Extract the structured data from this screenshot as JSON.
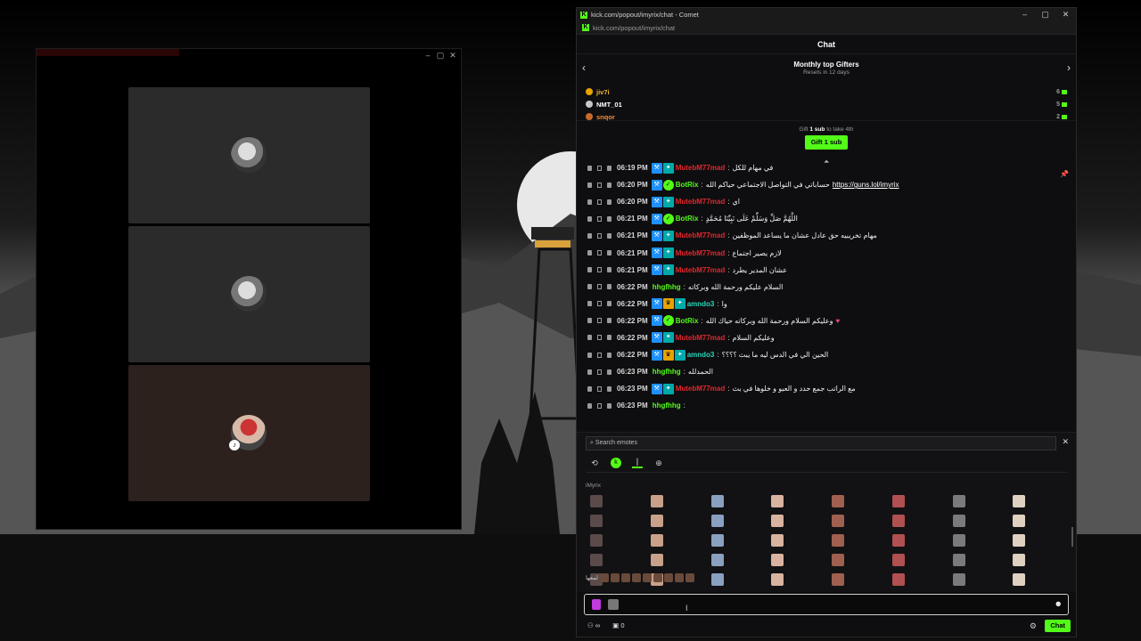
{
  "call_window": {
    "tiles": [
      {
        "kind": "avatar"
      },
      {
        "kind": "avatar"
      },
      {
        "kind": "avatar-muted"
      }
    ]
  },
  "browser": {
    "title": "kick.com/popout/imyrix/chat - Comet",
    "url": "kick.com/popout/imyrix/chat",
    "controls": {
      "minimize": "–",
      "maximize": "▢",
      "close": "✕"
    }
  },
  "chat": {
    "header": "Chat",
    "gifters": {
      "title": "Monthly top Gifters",
      "subtitle": "Resets in 12 days",
      "list": [
        {
          "name": "jiv7i",
          "count": "6",
          "color": "#e8a300",
          "name_color": "#f0b429"
        },
        {
          "name": "NMT_01",
          "count": "5",
          "color": "#c7c7c7",
          "name_color": "#ffffff"
        },
        {
          "name": "snqor",
          "count": "2",
          "color": "#c96a2a",
          "name_color": "#f08a3a"
        }
      ],
      "cta_prefix": "Gift",
      "cta_bold": "1 sub",
      "cta_suffix": "to take 4th",
      "gift_button": "Gift 1 sub"
    },
    "messages": [
      {
        "time": "06:19 PM",
        "badges": [
          "blue",
          "teal"
        ],
        "user": "MutebM77mad",
        "user_class": "u-red",
        "text": "في مهام للكل"
      },
      {
        "time": "06:20 PM",
        "badges": [
          "blue",
          "green"
        ],
        "user": "BotRix",
        "user_class": "u-green",
        "text": "حساباتي في التواصل الاجتماعي حياكم الله",
        "link": "https://guns.lol/imyrix"
      },
      {
        "time": "06:20 PM",
        "badges": [
          "blue",
          "teal"
        ],
        "user": "MutebM77mad",
        "user_class": "u-red",
        "text": "اي"
      },
      {
        "time": "06:21 PM",
        "badges": [
          "blue",
          "green"
        ],
        "user": "BotRix",
        "user_class": "u-green",
        "text": "اللَّهُمَّ صَلِّ وَسَلِّمْ عَلَى نَبِيِّنَا مُحَمَّدٍ"
      },
      {
        "time": "06:21 PM",
        "badges": [
          "blue",
          "teal"
        ],
        "user": "MutebM77mad",
        "user_class": "u-red",
        "text": "مهام تخريبيه حق عادل عشان ما يساعد الموظفين"
      },
      {
        "time": "06:21 PM",
        "badges": [
          "blue",
          "teal"
        ],
        "user": "MutebM77mad",
        "user_class": "u-red",
        "text": "لازم يصير اجتماع"
      },
      {
        "time": "06:21 PM",
        "badges": [
          "blue",
          "teal"
        ],
        "user": "MutebM77mad",
        "user_class": "u-red",
        "text": "عشان المدير يطرد"
      },
      {
        "time": "06:22 PM",
        "badges": [],
        "user": "hhgfhhg",
        "user_class": "u-lime",
        "text": "السلام عليكم ورحمة الله وبركاته"
      },
      {
        "time": "06:22 PM",
        "badges": [
          "blue",
          "gold",
          "teal"
        ],
        "user": "amndo3",
        "user_class": "u-teal",
        "text": "وا"
      },
      {
        "time": "06:22 PM",
        "badges": [
          "blue",
          "green"
        ],
        "user": "BotRix",
        "user_class": "u-green",
        "text": "وعليكم السلام ورحمة الله وبركاته حياك الله",
        "heart": "♥"
      },
      {
        "time": "06:22 PM",
        "badges": [
          "blue",
          "teal"
        ],
        "user": "MutebM77mad",
        "user_class": "u-red",
        "text": "وعليكم السلام"
      },
      {
        "time": "06:22 PM",
        "badges": [
          "blue",
          "gold",
          "teal"
        ],
        "user": "amndo3",
        "user_class": "u-teal",
        "text": "الحين الي في الدس ليه ما يبث ؟؟؟؟"
      },
      {
        "time": "06:23 PM",
        "badges": [],
        "user": "hhgfhhg",
        "user_class": "u-lime",
        "text": "الحمدلله"
      },
      {
        "time": "06:23 PM",
        "badges": [
          "blue",
          "teal"
        ],
        "user": "MutebM77mad",
        "user_class": "u-red",
        "text": "مع الراتب جمع حدد و العبو و خلوها في بث"
      },
      {
        "time": "06:23 PM",
        "badges": [],
        "user": "hhgfhhg",
        "user_class": "u-lime",
        "text": ""
      }
    ],
    "emotes": {
      "search_placeholder": "Search emotes",
      "tabs": [
        "history-icon",
        "kick-icon",
        "channel-icon",
        "globe-icon"
      ],
      "category": "iMyrix",
      "recent_label": "لمعها"
    },
    "input": {
      "value": ""
    },
    "footer": {
      "viewers": "∞",
      "count": "0",
      "send": "Chat"
    }
  }
}
